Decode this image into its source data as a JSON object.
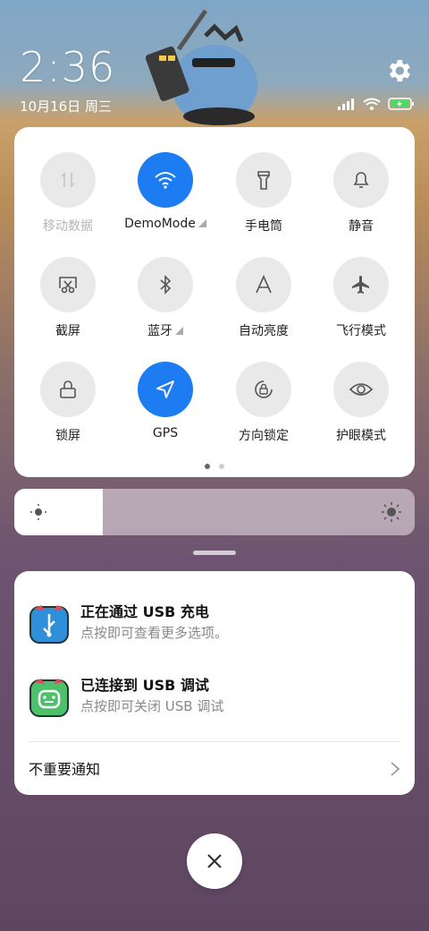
{
  "status": {
    "time": "2:36",
    "date": "10月16日 周三"
  },
  "quick_settings": {
    "tiles": [
      {
        "label": "移动数据",
        "on": false,
        "disabled": true,
        "icon": "mobile-data-icon"
      },
      {
        "label": "DemoMode",
        "on": true,
        "icon": "wifi-icon",
        "expandable": true
      },
      {
        "label": "手电筒",
        "on": false,
        "icon": "flashlight-icon"
      },
      {
        "label": "静音",
        "on": false,
        "icon": "bell-icon"
      },
      {
        "label": "截屏",
        "on": false,
        "icon": "screenshot-icon"
      },
      {
        "label": "蓝牙",
        "on": false,
        "icon": "bluetooth-icon",
        "expandable": true
      },
      {
        "label": "自动亮度",
        "on": false,
        "icon": "auto-brightness-icon"
      },
      {
        "label": "飞行模式",
        "on": false,
        "icon": "airplane-icon"
      },
      {
        "label": "锁屏",
        "on": false,
        "icon": "lock-icon"
      },
      {
        "label": "GPS",
        "on": true,
        "icon": "location-icon"
      },
      {
        "label": "方向锁定",
        "on": false,
        "icon": "rotation-lock-icon"
      },
      {
        "label": "护眼模式",
        "on": false,
        "icon": "eye-icon"
      }
    ],
    "page_count": 2,
    "current_page": 1
  },
  "brightness": {
    "level_fraction": 0.22
  },
  "notifications": [
    {
      "title": "正在通过 USB 充电",
      "body": "点按即可查看更多选项。",
      "icon": "usb-icon"
    },
    {
      "title": "已连接到 USB 调试",
      "body": "点按即可关闭 USB 调试",
      "icon": "android-icon"
    }
  ],
  "unimportant": {
    "label": "不重要通知"
  },
  "colors": {
    "accent": "#1d7cf2"
  }
}
